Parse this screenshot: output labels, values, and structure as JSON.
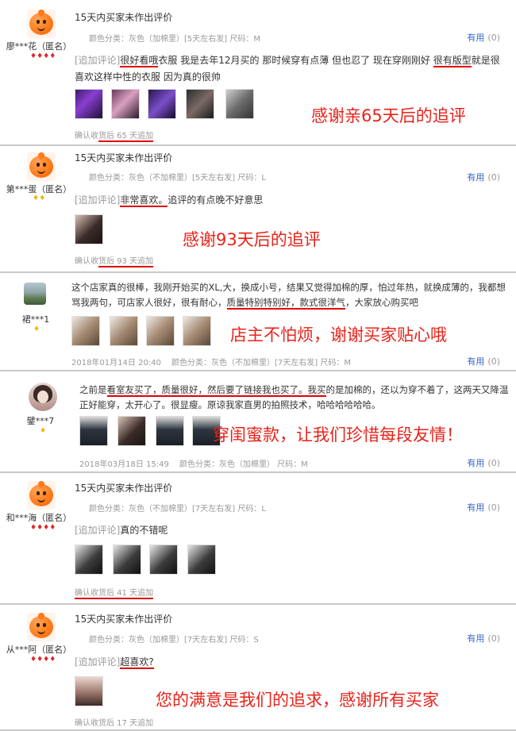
{
  "helpful_label": "有用",
  "helpful_count": "(0)",
  "append_tag": "[追加评论]",
  "reviews": [
    {
      "user": "廖***花（匿名）",
      "badge": "♦♦♦♦",
      "line1": "15天内买家未作出评价",
      "meta": "颜色分类：灰色（加棉里）[5天左右发]   尺码：M",
      "append_parts": [
        "很好看哦",
        "衣服 我是去年12月买的 那时候穿有点薄 但也忍了 现在穿刚刚好 ",
        "很有版型",
        "就是很喜欢这样中性的衣服 因为真的很帅"
      ],
      "confirm_prefix": "确认收",
      "confirm_u": "货后 65 天追加",
      "slogan": "感谢亲65天后的追评"
    },
    {
      "user": "第***蛋（匿名）",
      "badge": "♦♦",
      "line1": "15天内买家未作出评价",
      "meta": "颜色分类：灰色（不加棉里）[5天左右发]   尺码：L",
      "append_parts": [
        "非常喜欢。",
        "追评的有点晚不好意思"
      ],
      "confirm_prefix": "确认收",
      "confirm_u": "货后 93 天追加",
      "slogan": "感谢93天后的追评"
    },
    {
      "user": "裙***1",
      "badge": "♦",
      "body_parts": [
        "这个店家真的很棒，我刚开始买的XL,大，换成小号，结果又觉得加棉的厚，怕过年热，就换成薄的，我都想骂我两句，可店家人很好，很有耐心，",
        "质量特别特别好，款式很洋气",
        "，大家放心购买吧"
      ],
      "date": "2018年01月14日 20:40",
      "meta": "颜色分类：灰色（不加棉里）[7天左右发]   尺码：M",
      "slogan": "店主不怕烦，谢谢买家贴心哦"
    },
    {
      "user": "鐾***7",
      "badge": "♦",
      "body_parts": [
        "之前是",
        "看室友买了，质量很好，然后要了链接我也买了。",
        "我买",
        "的是加棉的，还以为穿不着了，这两天又降温正好能穿，太开心了。很显瘦。原谅我家直男的拍照技术，哈哈哈哈哈哈。"
      ],
      "date": "2018年03月18日 15:49",
      "meta": "颜色分类：灰色（加棉里）   尺码：M",
      "slogan": "穿闺蜜款，让我们珍惜每段友情！"
    },
    {
      "user": "和***海（匿名）",
      "badge": "♦♦♦♦",
      "line1": "15天内买家未作出评价",
      "meta": "颜色分类：灰色（不加棉里）[7天左右发]   尺码：L",
      "append_parts": [
        "真的不错呢"
      ],
      "confirm_prefix": "",
      "confirm_u": "确认收货后 41 天追加"
    },
    {
      "user": "从***阿（匿名）",
      "badge": "♦♦♦♦",
      "line1": "15天内买家未作出评价",
      "meta": "颜色分类：灰色（加棉里）[7天左右发]   尺码：S",
      "append_parts": [
        "超喜欢?"
      ],
      "confirm": "确认收货后 17 天追加",
      "slogan": "您的满意是我们的追求，感谢所有买家"
    }
  ],
  "colors": {
    "slogan": "#e8231a",
    "underline": "#e00000",
    "link": "#3366cc"
  },
  "icons": [
    "taobao-avatar",
    "scenery-avatar",
    "girl-avatar",
    "red-diamond-icon",
    "gold-diamond-icon"
  ]
}
